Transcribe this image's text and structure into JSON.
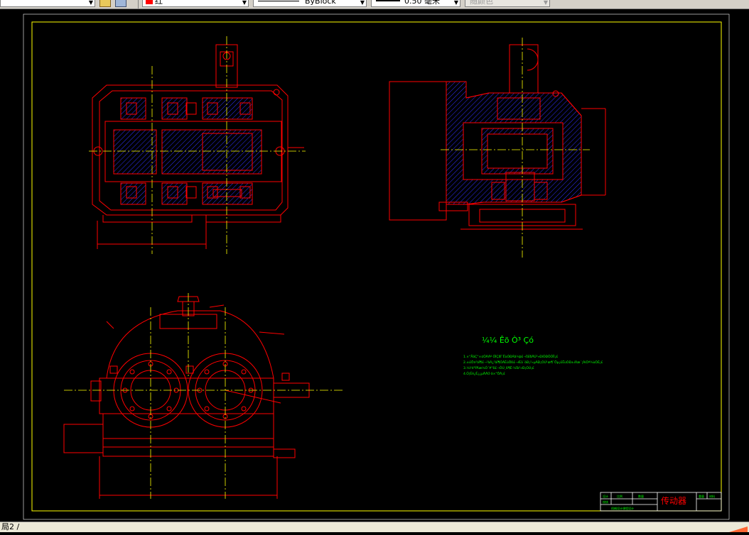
{
  "toolbar": {
    "color_value": "红",
    "linetype_value": "ByBlock",
    "lineweight_value": "0.50 毫米",
    "plotstyle_value": "随颜色"
  },
  "colors": {
    "background": "#000000",
    "drawing_red": "#ff0000",
    "border_yellow": "#ffff00",
    "centerline_yellow": "#ffff00",
    "hatch_blue": "#3030ff",
    "note_green": "#00ff00",
    "toolbar_gray": "#d4d0c8"
  },
  "drawing": {
    "notes_heading": "¼¼ Êõ Ò³ Çó",
    "notes": [
      "1.×°ÅäÇ°×¢ÓÃÃº ÓÍÇåÏ´ËùÓÐÁã¼þ£¬ÏäÌåÄÚ²»ÐíÓÐÔÓÎï¡£",
      "2.±£Ö¤²àÏ¶£¬²âÁ¿²àÏ¶ÓÃÈûÖß£¬Æä´óÐ¡²»µÃÐ¡ÓÚ¹æ¶¨Öµ¡£ËùÓÐ±íÃæ´¦ÀíÒª¾ùÔÈ¡£",
      "3.¼ì²é³ÝÃæ½Ó´¥°ß£¬ÔÚ¸ß¶È·½Ïò²»Ð¡ÓÚ¡£",
      "4.Ó¦Éè¿É¿¿µÄÃÜ·â×°ÖÃ¡£"
    ],
    "title_block": {
      "drawing_name": "传动器",
      "cells": [
        "设计",
        "校核",
        "比例",
        "数量",
        "重量",
        "材料"
      ],
      "footer": "机械设计课程设计"
    }
  },
  "status": {
    "layout_tab": "局2 /"
  }
}
